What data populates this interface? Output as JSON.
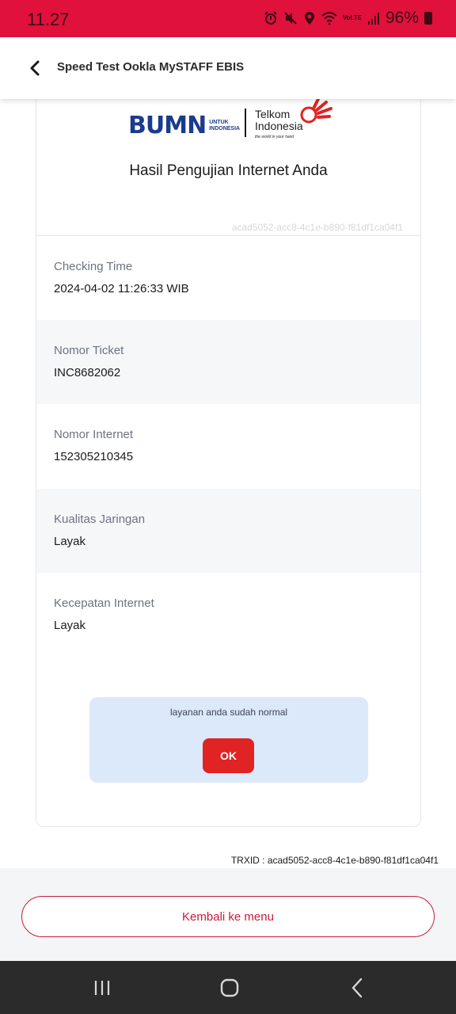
{
  "status_bar": {
    "time": "11.27",
    "battery": "96%",
    "icons": [
      "alarm-icon",
      "mute-icon",
      "location-icon",
      "wifi-icon",
      "volte-icon",
      "signal-icon",
      "battery-icon"
    ],
    "volte_label": "VoLTE"
  },
  "header": {
    "back_icon": "chevron-left-icon",
    "title": "Speed Test Ookla MySTAFF EBIS"
  },
  "logos": {
    "bumn": "BUMN",
    "bumn_sub_1": "UNTUK",
    "bumn_sub_2": "INDONESIA",
    "telkom_1": "Telkom",
    "telkom_2": "Indonesia",
    "telkom_tagline": "the world in your hand"
  },
  "result": {
    "title": "Hasil Pengujian Internet Anda",
    "id": "acad5052-acc8-4c1e-b890-f81df1ca04f1",
    "rows": [
      {
        "label": "Checking Time",
        "value": "2024-04-02 11:26:33 WIB"
      },
      {
        "label": "Nomor Ticket",
        "value": "INC8682062"
      },
      {
        "label": "Nomor Internet",
        "value": "152305210345"
      },
      {
        "label": "Kualitas Jaringan",
        "value": "Layak"
      },
      {
        "label": "Kecepatan Internet",
        "value": "Layak"
      }
    ]
  },
  "notice": {
    "message": "layanan anda sudah normal",
    "ok_label": "OK"
  },
  "trxid": "TRXID : acad5052-acc8-4c1e-b890-f81df1ca04f1",
  "footer": {
    "menu_button": "Kembali ke menu"
  },
  "nav_bar": {
    "icons": [
      "recent-apps-icon",
      "home-icon",
      "back-icon"
    ]
  },
  "colors": {
    "status_bar": "#e0113a",
    "accent_red": "#c8193c",
    "ok_button": "#e02323",
    "notice_bg": "#dce9fb"
  }
}
